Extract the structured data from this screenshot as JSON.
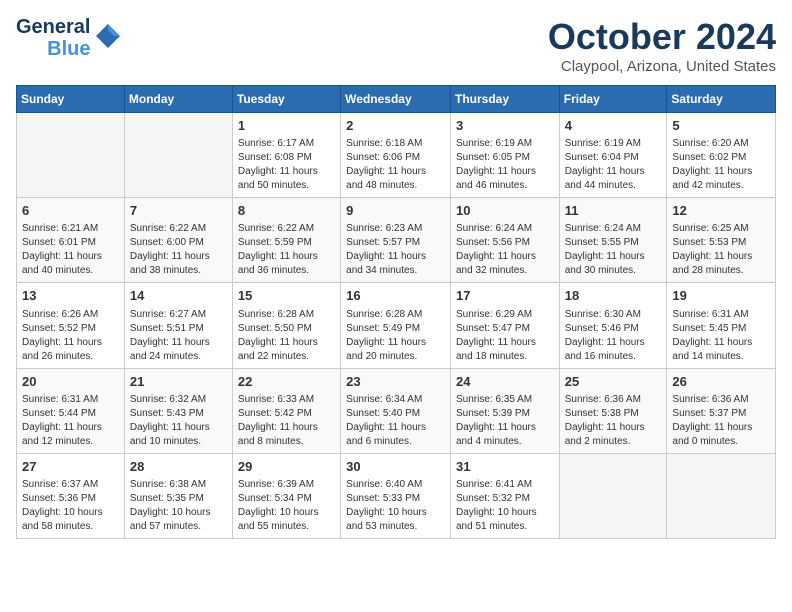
{
  "logo": {
    "line1": "General",
    "line2": "Blue"
  },
  "title": "October 2024",
  "subtitle": "Claypool, Arizona, United States",
  "days_of_week": [
    "Sunday",
    "Monday",
    "Tuesday",
    "Wednesday",
    "Thursday",
    "Friday",
    "Saturday"
  ],
  "weeks": [
    [
      {
        "day": "",
        "info": ""
      },
      {
        "day": "",
        "info": ""
      },
      {
        "day": "1",
        "info": "Sunrise: 6:17 AM\nSunset: 6:08 PM\nDaylight: 11 hours and 50 minutes."
      },
      {
        "day": "2",
        "info": "Sunrise: 6:18 AM\nSunset: 6:06 PM\nDaylight: 11 hours and 48 minutes."
      },
      {
        "day": "3",
        "info": "Sunrise: 6:19 AM\nSunset: 6:05 PM\nDaylight: 11 hours and 46 minutes."
      },
      {
        "day": "4",
        "info": "Sunrise: 6:19 AM\nSunset: 6:04 PM\nDaylight: 11 hours and 44 minutes."
      },
      {
        "day": "5",
        "info": "Sunrise: 6:20 AM\nSunset: 6:02 PM\nDaylight: 11 hours and 42 minutes."
      }
    ],
    [
      {
        "day": "6",
        "info": "Sunrise: 6:21 AM\nSunset: 6:01 PM\nDaylight: 11 hours and 40 minutes."
      },
      {
        "day": "7",
        "info": "Sunrise: 6:22 AM\nSunset: 6:00 PM\nDaylight: 11 hours and 38 minutes."
      },
      {
        "day": "8",
        "info": "Sunrise: 6:22 AM\nSunset: 5:59 PM\nDaylight: 11 hours and 36 minutes."
      },
      {
        "day": "9",
        "info": "Sunrise: 6:23 AM\nSunset: 5:57 PM\nDaylight: 11 hours and 34 minutes."
      },
      {
        "day": "10",
        "info": "Sunrise: 6:24 AM\nSunset: 5:56 PM\nDaylight: 11 hours and 32 minutes."
      },
      {
        "day": "11",
        "info": "Sunrise: 6:24 AM\nSunset: 5:55 PM\nDaylight: 11 hours and 30 minutes."
      },
      {
        "day": "12",
        "info": "Sunrise: 6:25 AM\nSunset: 5:53 PM\nDaylight: 11 hours and 28 minutes."
      }
    ],
    [
      {
        "day": "13",
        "info": "Sunrise: 6:26 AM\nSunset: 5:52 PM\nDaylight: 11 hours and 26 minutes."
      },
      {
        "day": "14",
        "info": "Sunrise: 6:27 AM\nSunset: 5:51 PM\nDaylight: 11 hours and 24 minutes."
      },
      {
        "day": "15",
        "info": "Sunrise: 6:28 AM\nSunset: 5:50 PM\nDaylight: 11 hours and 22 minutes."
      },
      {
        "day": "16",
        "info": "Sunrise: 6:28 AM\nSunset: 5:49 PM\nDaylight: 11 hours and 20 minutes."
      },
      {
        "day": "17",
        "info": "Sunrise: 6:29 AM\nSunset: 5:47 PM\nDaylight: 11 hours and 18 minutes."
      },
      {
        "day": "18",
        "info": "Sunrise: 6:30 AM\nSunset: 5:46 PM\nDaylight: 11 hours and 16 minutes."
      },
      {
        "day": "19",
        "info": "Sunrise: 6:31 AM\nSunset: 5:45 PM\nDaylight: 11 hours and 14 minutes."
      }
    ],
    [
      {
        "day": "20",
        "info": "Sunrise: 6:31 AM\nSunset: 5:44 PM\nDaylight: 11 hours and 12 minutes."
      },
      {
        "day": "21",
        "info": "Sunrise: 6:32 AM\nSunset: 5:43 PM\nDaylight: 11 hours and 10 minutes."
      },
      {
        "day": "22",
        "info": "Sunrise: 6:33 AM\nSunset: 5:42 PM\nDaylight: 11 hours and 8 minutes."
      },
      {
        "day": "23",
        "info": "Sunrise: 6:34 AM\nSunset: 5:40 PM\nDaylight: 11 hours and 6 minutes."
      },
      {
        "day": "24",
        "info": "Sunrise: 6:35 AM\nSunset: 5:39 PM\nDaylight: 11 hours and 4 minutes."
      },
      {
        "day": "25",
        "info": "Sunrise: 6:36 AM\nSunset: 5:38 PM\nDaylight: 11 hours and 2 minutes."
      },
      {
        "day": "26",
        "info": "Sunrise: 6:36 AM\nSunset: 5:37 PM\nDaylight: 11 hours and 0 minutes."
      }
    ],
    [
      {
        "day": "27",
        "info": "Sunrise: 6:37 AM\nSunset: 5:36 PM\nDaylight: 10 hours and 58 minutes."
      },
      {
        "day": "28",
        "info": "Sunrise: 6:38 AM\nSunset: 5:35 PM\nDaylight: 10 hours and 57 minutes."
      },
      {
        "day": "29",
        "info": "Sunrise: 6:39 AM\nSunset: 5:34 PM\nDaylight: 10 hours and 55 minutes."
      },
      {
        "day": "30",
        "info": "Sunrise: 6:40 AM\nSunset: 5:33 PM\nDaylight: 10 hours and 53 minutes."
      },
      {
        "day": "31",
        "info": "Sunrise: 6:41 AM\nSunset: 5:32 PM\nDaylight: 10 hours and 51 minutes."
      },
      {
        "day": "",
        "info": ""
      },
      {
        "day": "",
        "info": ""
      }
    ]
  ]
}
